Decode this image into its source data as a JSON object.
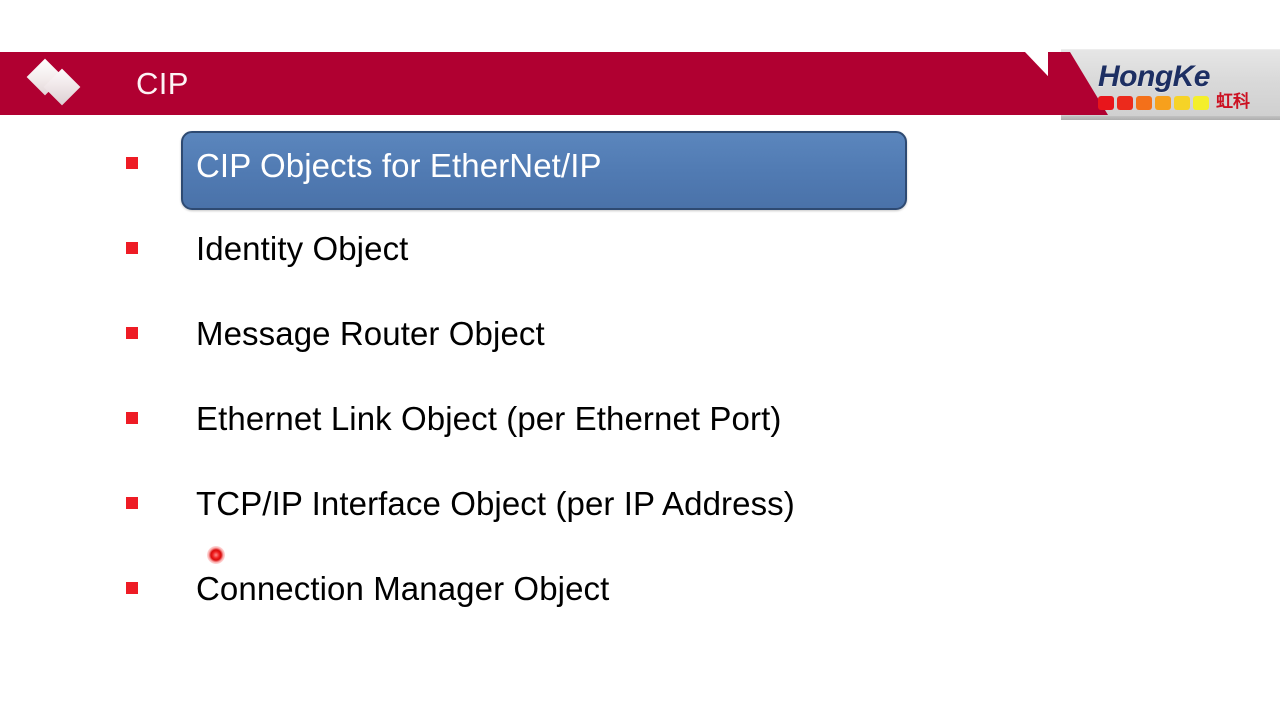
{
  "header": {
    "title": "CIP",
    "band_color": "#b00031",
    "logo_icon": "overlapping-diamonds-icon"
  },
  "logo": {
    "wordmark": "HongKe",
    "wordmark_color": "#1d2f63",
    "chinese_name": "虹科",
    "chinese_name_color": "#cc1122",
    "swatch_colors": [
      "#e8151b",
      "#ec2a1c",
      "#f4701a",
      "#f7a01c",
      "#f6d327",
      "#f4ef2a"
    ]
  },
  "slide": {
    "background_color": "#ffffff",
    "bullet_marker_color": "#ee1c25",
    "highlight": {
      "fill_top": "#5b86bd",
      "fill_bottom": "#4a72a9",
      "border_color": "#2e4a72",
      "text_color": "#ffffff"
    },
    "bullets": [
      {
        "label": "CIP Objects for EtherNet/IP",
        "highlighted": true
      },
      {
        "label": "Identity Object",
        "highlighted": false
      },
      {
        "label": "Message Router Object",
        "highlighted": false
      },
      {
        "label": "Ethernet Link Object (per Ethernet Port)",
        "highlighted": false
      },
      {
        "label": "TCP/IP Interface Object (per IP Address)",
        "highlighted": false
      },
      {
        "label": "Connection Manager Object",
        "highlighted": false
      }
    ]
  },
  "pointer": {
    "type": "laser-pointer-dot",
    "color": "#ef2020"
  }
}
